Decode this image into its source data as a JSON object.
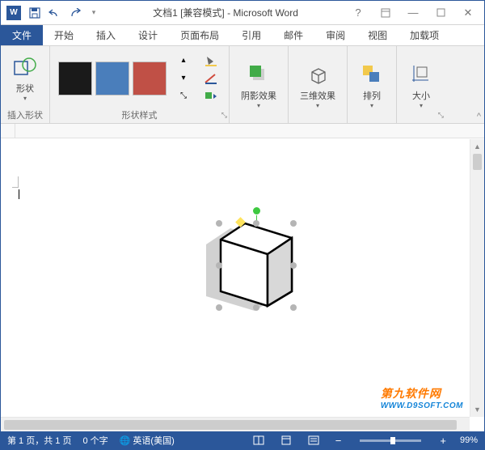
{
  "title": "文档1 [兼容模式] - Microsoft Word",
  "tabs": {
    "file": "文件",
    "home": "开始",
    "insert": "插入",
    "design": "设计",
    "layout": "页面布局",
    "references": "引用",
    "mailings": "邮件",
    "review": "审阅",
    "view": "视图",
    "addins": "加载项"
  },
  "ribbon": {
    "shapes_group": "插入形状",
    "shapes_btn": "形状",
    "styles_group": "形状样式",
    "shadow_btn": "阴影效果",
    "threed_btn": "三维效果",
    "arrange_btn": "排列",
    "size_btn": "大小",
    "style_colors": [
      "#1a1a1a",
      "#4a7ebb",
      "#c05046"
    ]
  },
  "status": {
    "page": "第 1 页，共 1 页",
    "words": "0 个字",
    "lang": "英语(美国)",
    "zoom": "99%"
  },
  "watermark": {
    "line1": "第九软件网",
    "line2": "WWW.D9SOFT.COM"
  }
}
